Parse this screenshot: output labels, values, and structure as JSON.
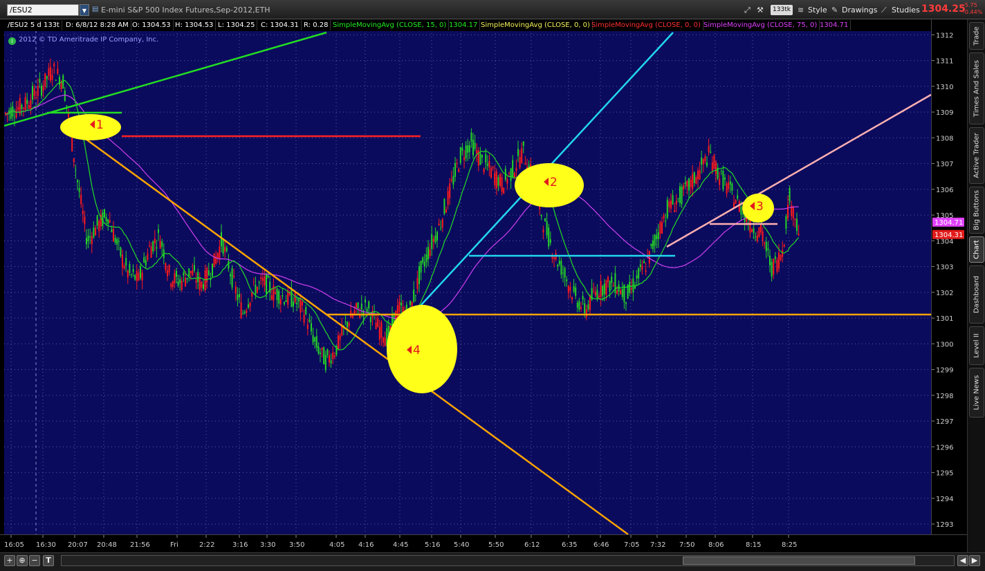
{
  "toolbar": {
    "symbol": "/ESU2",
    "description": "E-mini S&P 500 Index Futures,Sep-2012,ETH",
    "aggregation": "133tk",
    "style_label": "Style",
    "drawings_label": "Drawings",
    "studies_label": "Studies",
    "last_price": "1304.25",
    "net_change": "-5.75",
    "pct_change": "-0.44%"
  },
  "header": {
    "cells": [
      {
        "text": "/ESU2 5 d 133t",
        "color": "#ffffff"
      },
      {
        "text": "D: 6/8/12 8:28 AM",
        "color": "#ffffff"
      },
      {
        "text": "O: 1304.53",
        "color": "#ffffff"
      },
      {
        "text": "H: 1304.53",
        "color": "#ffffff"
      },
      {
        "text": "L: 1304.25",
        "color": "#ffffff"
      },
      {
        "text": "C: 1304.31",
        "color": "#ffffff"
      },
      {
        "text": "R: 0.28",
        "color": "#ffffff"
      },
      {
        "text": "SimpleMovingAvg (CLOSE, 15, 0)",
        "color": "#22ee22"
      },
      {
        "text": "1304.17",
        "color": "#22ee22"
      },
      {
        "text": "SimpleMovingAvg (CLOSE, 0, 0)",
        "color": "#f2f25a"
      },
      {
        "text": "SimpleMovingAvg (CLOSE, 0, 0)",
        "color": "#ff3030"
      },
      {
        "text": "SimpleMovingAvg (CLOSE, 75, 0)",
        "color": "#e040ff"
      },
      {
        "text": "1304.71",
        "color": "#e040ff"
      }
    ]
  },
  "copyright": "2012 © TD Ameritrade IP Company, Inc.",
  "price_labels": [
    {
      "text": "1304.71",
      "bg": "#e040ff"
    },
    {
      "text": "1304.31",
      "bg": "#e31b1b"
    }
  ],
  "right_tabs": [
    {
      "label": "Trade",
      "active": false
    },
    {
      "label": "Times And Sales",
      "active": false
    },
    {
      "label": "Active Trader",
      "active": false
    },
    {
      "label": "Big Buttons",
      "active": false
    },
    {
      "label": "Chart",
      "active": true
    },
    {
      "label": "Dashboard",
      "active": false
    },
    {
      "label": "Level II",
      "active": false
    },
    {
      "label": "Live News",
      "active": false
    }
  ],
  "annotations": [
    "1",
    "2",
    "3",
    "4"
  ],
  "chart_data": {
    "type": "candlestick",
    "y_ticks": [
      1312,
      1311,
      1310,
      1309,
      1308,
      1307,
      1306,
      1305,
      1304,
      1303,
      1302,
      1301,
      1300,
      1299,
      1298,
      1297,
      1296,
      1295,
      1294,
      1293
    ],
    "x_ticks": [
      "16:05",
      "16:30",
      "20:07",
      "20:48",
      "21:56",
      "Fri",
      "2:22",
      "3:16",
      "3:30",
      "3:50",
      "4:05",
      "4:16",
      "4:45",
      "5:16",
      "5:40",
      "5:50",
      "6:12",
      "6:35",
      "6:46",
      "7:05",
      "7:32",
      "7:50",
      "8:06",
      "8:15",
      "8:25"
    ],
    "ylim": [
      1292.6,
      1312.6
    ],
    "grid": true,
    "price_path": [
      [
        0,
        1308.9
      ],
      [
        30,
        1309.3
      ],
      [
        55,
        1310.0
      ],
      [
        70,
        1310.7
      ],
      [
        85,
        1310.2
      ],
      [
        95,
        1308.5
      ],
      [
        105,
        1306.5
      ],
      [
        120,
        1304.0
      ],
      [
        135,
        1304.6
      ],
      [
        150,
        1305.0
      ],
      [
        165,
        1303.7
      ],
      [
        180,
        1302.7
      ],
      [
        195,
        1302.5
      ],
      [
        210,
        1303.7
      ],
      [
        225,
        1304.2
      ],
      [
        240,
        1302.6
      ],
      [
        255,
        1302.4
      ],
      [
        270,
        1302.8
      ],
      [
        285,
        1302.3
      ],
      [
        300,
        1302.9
      ],
      [
        315,
        1304.0
      ],
      [
        330,
        1302.5
      ],
      [
        345,
        1301.2
      ],
      [
        360,
        1302.1
      ],
      [
        375,
        1302.4
      ],
      [
        390,
        1302.0
      ],
      [
        405,
        1301.8
      ],
      [
        420,
        1301.7
      ],
      [
        435,
        1301.2
      ],
      [
        450,
        1300.0
      ],
      [
        465,
        1299.3
      ],
      [
        480,
        1299.8
      ],
      [
        495,
        1300.8
      ],
      [
        510,
        1301.3
      ],
      [
        525,
        1301.4
      ],
      [
        540,
        1300.7
      ],
      [
        555,
        1300.2
      ],
      [
        570,
        1301.4
      ],
      [
        585,
        1301.1
      ],
      [
        600,
        1302.6
      ],
      [
        615,
        1303.7
      ],
      [
        630,
        1304.6
      ],
      [
        645,
        1306.0
      ],
      [
        660,
        1307.3
      ],
      [
        675,
        1307.8
      ],
      [
        690,
        1307.1
      ],
      [
        705,
        1306.7
      ],
      [
        720,
        1306.2
      ],
      [
        735,
        1306.7
      ],
      [
        750,
        1307.5
      ],
      [
        765,
        1306.4
      ],
      [
        780,
        1304.7
      ],
      [
        795,
        1303.5
      ],
      [
        810,
        1302.7
      ],
      [
        825,
        1301.8
      ],
      [
        840,
        1301.3
      ],
      [
        855,
        1302.0
      ],
      [
        870,
        1302.3
      ],
      [
        885,
        1302.3
      ],
      [
        900,
        1301.8
      ],
      [
        915,
        1302.5
      ],
      [
        930,
        1303.2
      ],
      [
        945,
        1304.3
      ],
      [
        960,
        1305.3
      ],
      [
        975,
        1305.6
      ],
      [
        990,
        1306.1
      ],
      [
        1005,
        1306.7
      ],
      [
        1020,
        1307.4
      ],
      [
        1035,
        1306.5
      ],
      [
        1050,
        1305.9
      ],
      [
        1065,
        1305.3
      ],
      [
        1080,
        1304.6
      ],
      [
        1095,
        1304.3
      ],
      [
        1110,
        1302.9
      ],
      [
        1125,
        1303.6
      ],
      [
        1135,
        1305.7
      ],
      [
        1145,
        1304.8
      ],
      [
        1150,
        1304.3
      ]
    ]
  }
}
